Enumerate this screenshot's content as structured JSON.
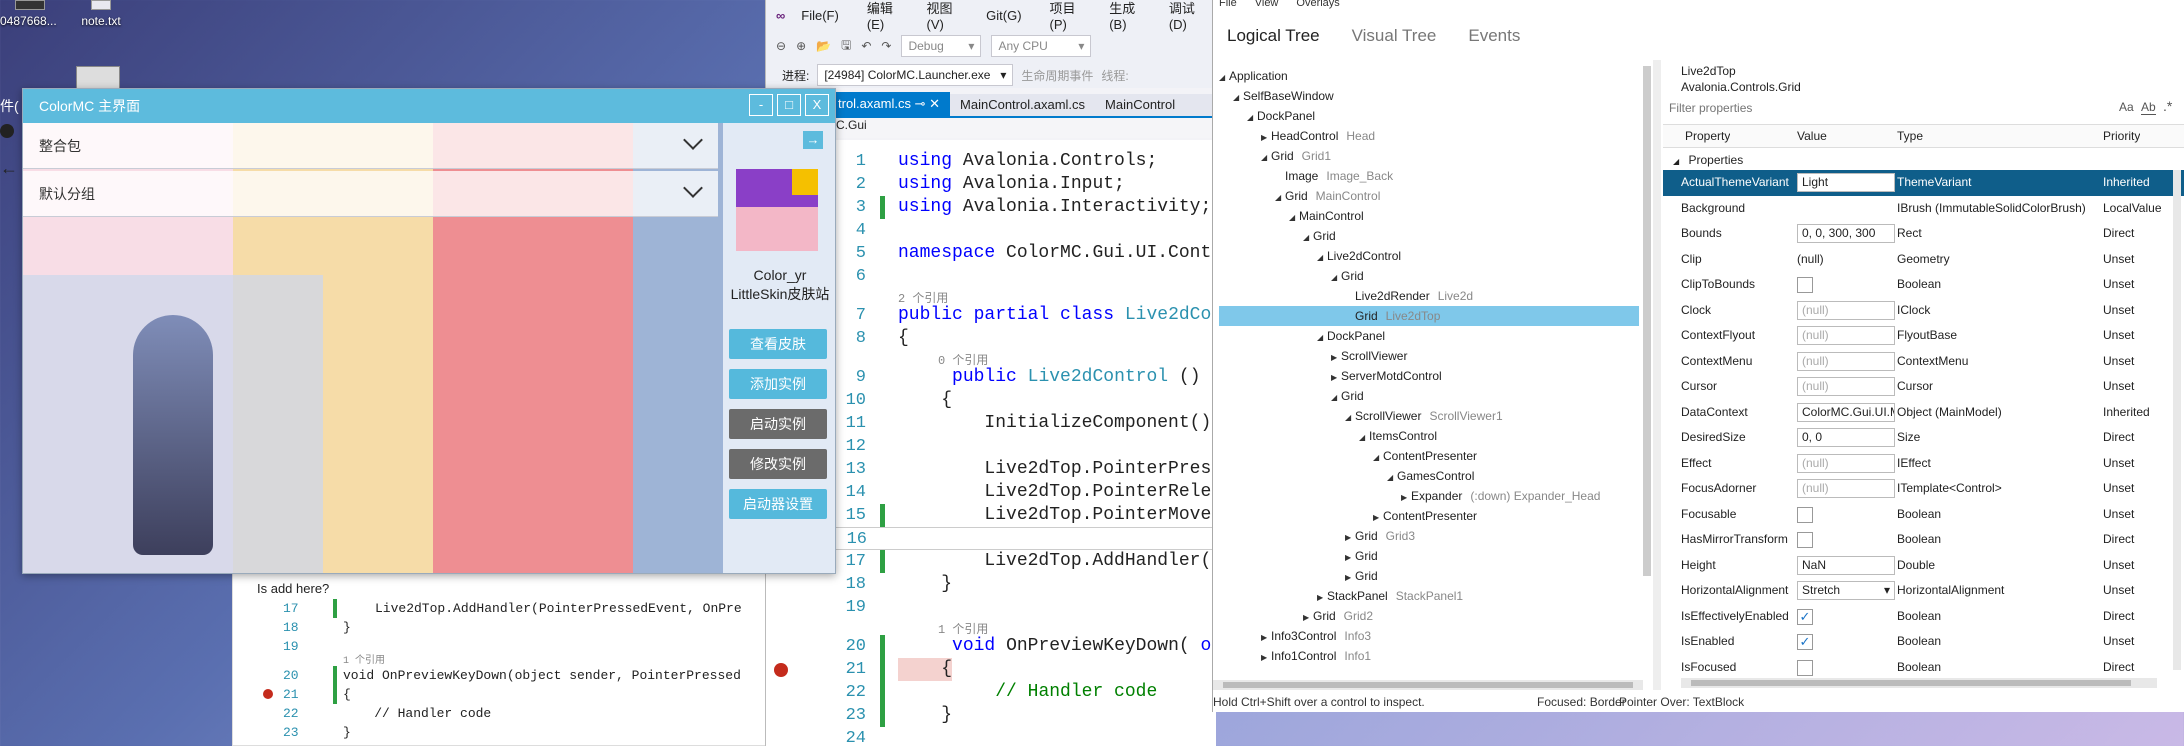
{
  "desktop": {
    "icons": [
      {
        "label": "0487668...",
        "icon": "image-file-icon"
      },
      {
        "label": "note.txt",
        "icon": "text-file-icon"
      }
    ],
    "left_fragment": "件(",
    "snippet_text": "Is add here?"
  },
  "vs": {
    "menu": [
      "File(F)",
      "编辑(E)",
      "视图(V)",
      "Git(G)",
      "项目(P)",
      "生成(B)",
      "调试(D)"
    ],
    "toolbar": {
      "config": "Debug",
      "platform": "Any CPU"
    },
    "process_label": "进程:",
    "process_value": "[24984] ColorMC.Launcher.exe",
    "lifecycle_label": "生命周期事件",
    "thread_label": "线程:",
    "tabs": [
      {
        "label": "trol.axaml.cs",
        "active": true
      },
      {
        "label": "MainControl.axaml.cs",
        "active": false
      },
      {
        "label": "MainControl",
        "active": false
      }
    ],
    "breadcrumb": "C.Gui",
    "code_lines": [
      {
        "n": "1",
        "tokens": [
          [
            "kw",
            "using"
          ],
          [
            "",
            "Avalonia.Controls;"
          ]
        ]
      },
      {
        "n": "2",
        "tokens": [
          [
            "kw",
            "using"
          ],
          [
            "",
            "Avalonia.Input;"
          ]
        ]
      },
      {
        "n": "3",
        "tokens": [
          [
            "kw",
            "using"
          ],
          [
            "",
            "Avalonia.Interactivity;"
          ]
        ]
      },
      {
        "n": "4",
        "tokens": []
      },
      {
        "n": "5",
        "tokens": [
          [
            "kw",
            "namespace"
          ],
          [
            "",
            "ColorMC.Gui.UI.Control"
          ]
        ]
      },
      {
        "n": "6",
        "tokens": []
      },
      {
        "n": "7",
        "tokens": [
          [
            "kw",
            "public partial class"
          ],
          [
            "ty",
            "Live2dCont"
          ]
        ]
      },
      {
        "n": "8",
        "tokens": [
          [
            "",
            "{"
          ]
        ]
      },
      {
        "n": "9",
        "tokens": [
          [
            "",
            "    "
          ],
          [
            "kw",
            "public"
          ],
          [
            "ty",
            "Live2dControl"
          ],
          [
            "",
            "()"
          ]
        ]
      },
      {
        "n": "10",
        "tokens": [
          [
            "",
            "    {"
          ]
        ]
      },
      {
        "n": "11",
        "tokens": [
          [
            "",
            "        InitializeComponent();"
          ]
        ]
      },
      {
        "n": "12",
        "tokens": []
      },
      {
        "n": "13",
        "tokens": [
          [
            "",
            "        Live2dTop.PointerPresse"
          ]
        ]
      },
      {
        "n": "14",
        "tokens": [
          [
            "",
            "        Live2dTop.PointerRelease"
          ]
        ]
      },
      {
        "n": "15",
        "tokens": [
          [
            "",
            "        Live2dTop.PointerMoved +"
          ]
        ]
      },
      {
        "n": "16",
        "tokens": []
      },
      {
        "n": "17",
        "tokens": [
          [
            "",
            "        Live2dTop.AddHandler(Poi"
          ]
        ]
      },
      {
        "n": "18",
        "tokens": [
          [
            "",
            "    }"
          ]
        ]
      },
      {
        "n": "19",
        "tokens": []
      },
      {
        "n": "20",
        "tokens": [
          [
            "",
            "    "
          ],
          [
            "kw",
            "void"
          ],
          [
            "",
            "OnPreviewKeyDown("
          ],
          [
            "kw",
            "object"
          ]
        ]
      },
      {
        "n": "21",
        "tokens": [
          [
            "",
            "    {"
          ]
        ]
      },
      {
        "n": "22",
        "tokens": [
          [
            "",
            "        "
          ],
          [
            "cm",
            "// Handler code"
          ]
        ]
      },
      {
        "n": "23",
        "tokens": [
          [
            "",
            "    }"
          ]
        ]
      },
      {
        "n": "24",
        "tokens": []
      }
    ],
    "refs": {
      "r2": "2 个引用",
      "r0": "0 个引用",
      "r1": "1 个引用"
    }
  },
  "bg_editor": {
    "lines": [
      {
        "n": "17",
        "text": "Live2dTop.AddHandler(PointerPressedEvent, OnPre"
      },
      {
        "n": "18",
        "text": "}"
      },
      {
        "n": "19",
        "text": ""
      },
      {
        "n": "20",
        "text": "void OnPreviewKeyDown(object sender, PointerPressed"
      },
      {
        "n": "21",
        "text": "{"
      },
      {
        "n": "22",
        "text": "    // Handler code"
      },
      {
        "n": "23",
        "text": "}"
      }
    ],
    "ref_label": "1 个引用"
  },
  "colormc": {
    "title": "ColorMC 主界面",
    "groups": [
      "整合包",
      "默认分组"
    ],
    "user_name": "Color_yr",
    "user_type": "LittleSkin皮肤站",
    "buttons": [
      {
        "label": "查看皮肤",
        "enabled": true
      },
      {
        "label": "添加实例",
        "enabled": true
      },
      {
        "label": "启动实例",
        "enabled": false
      },
      {
        "label": "修改实例",
        "enabled": false
      },
      {
        "label": "启动器设置",
        "enabled": true
      }
    ],
    "window_buttons": [
      "-",
      "□",
      "X"
    ]
  },
  "inspector": {
    "menu": [
      "File",
      "View",
      "Overlays"
    ],
    "tabs": [
      "Logical Tree",
      "Visual Tree",
      "Events"
    ],
    "tree": [
      {
        "indent": 0,
        "exp": "open",
        "name": "Application",
        "tname": ""
      },
      {
        "indent": 1,
        "exp": "open",
        "name": "SelfBaseWindow",
        "tname": ""
      },
      {
        "indent": 2,
        "exp": "open",
        "name": "DockPanel",
        "tname": ""
      },
      {
        "indent": 3,
        "exp": "closed",
        "name": "HeadControl",
        "tname": "Head"
      },
      {
        "indent": 3,
        "exp": "open",
        "name": "Grid",
        "tname": "Grid1"
      },
      {
        "indent": 4,
        "exp": "",
        "name": "Image",
        "tname": "Image_Back"
      },
      {
        "indent": 4,
        "exp": "open",
        "name": "Grid",
        "tname": "MainControl"
      },
      {
        "indent": 5,
        "exp": "open",
        "name": "MainControl",
        "tname": ""
      },
      {
        "indent": 6,
        "exp": "open",
        "name": "Grid",
        "tname": ""
      },
      {
        "indent": 7,
        "exp": "open",
        "name": "Live2dControl",
        "tname": ""
      },
      {
        "indent": 8,
        "exp": "open",
        "name": "Grid",
        "tname": ""
      },
      {
        "indent": 9,
        "exp": "",
        "name": "Live2dRender",
        "tname": "Live2d"
      },
      {
        "indent": 9,
        "exp": "",
        "name": "Grid",
        "tname": "Live2dTop",
        "selected": true
      },
      {
        "indent": 7,
        "exp": "open",
        "name": "DockPanel",
        "tname": ""
      },
      {
        "indent": 8,
        "exp": "closed",
        "name": "ScrollViewer",
        "tname": ""
      },
      {
        "indent": 8,
        "exp": "closed",
        "name": "ServerMotdControl",
        "tname": ""
      },
      {
        "indent": 8,
        "exp": "open",
        "name": "Grid",
        "tname": ""
      },
      {
        "indent": 9,
        "exp": "open",
        "name": "ScrollViewer",
        "tname": "ScrollViewer1"
      },
      {
        "indent": 10,
        "exp": "open",
        "name": "ItemsControl",
        "tname": ""
      },
      {
        "indent": 11,
        "exp": "open",
        "name": "ContentPresenter",
        "tname": ""
      },
      {
        "indent": 12,
        "exp": "open",
        "name": "GamesControl",
        "tname": ""
      },
      {
        "indent": 13,
        "exp": "closed",
        "name": "Expander",
        "tname": "(:down)  Expander_Head"
      },
      {
        "indent": 11,
        "exp": "closed",
        "name": "ContentPresenter",
        "tname": ""
      },
      {
        "indent": 9,
        "exp": "closed",
        "name": "Grid",
        "tname": "Grid3"
      },
      {
        "indent": 9,
        "exp": "closed",
        "name": "Grid",
        "tname": ""
      },
      {
        "indent": 9,
        "exp": "closed",
        "name": "Grid",
        "tname": ""
      },
      {
        "indent": 7,
        "exp": "closed",
        "name": "StackPanel",
        "tname": "StackPanel1"
      },
      {
        "indent": 6,
        "exp": "closed",
        "name": "Grid",
        "tname": "Grid2"
      },
      {
        "indent": 3,
        "exp": "closed",
        "name": "Info3Control",
        "tname": "Info3"
      },
      {
        "indent": 3,
        "exp": "closed",
        "name": "Info1Control",
        "tname": "Info1"
      }
    ],
    "selected_name": "Live2dTop",
    "selected_type": "Avalonia.Controls.Grid",
    "filter_placeholder": "Filter properties",
    "columns": [
      "Property",
      "Value",
      "Type",
      "Priority"
    ],
    "group_label": "Properties",
    "properties": [
      {
        "name": "ActualThemeVariant",
        "value": "Light",
        "kind": "box",
        "type": "ThemeVariant",
        "priority": "Inherited",
        "selected": true
      },
      {
        "name": "Background",
        "value": "",
        "kind": "none",
        "type": "IBrush (ImmutableSolidColorBrush)",
        "priority": "LocalValue"
      },
      {
        "name": "Bounds",
        "value": "0, 0, 300, 300",
        "kind": "box",
        "type": "Rect",
        "priority": "Direct"
      },
      {
        "name": "Clip",
        "value": "(null)",
        "kind": "text",
        "type": "Geometry",
        "priority": "Unset"
      },
      {
        "name": "ClipToBounds",
        "value": "",
        "kind": "check",
        "checked": false,
        "type": "Boolean",
        "priority": "Unset"
      },
      {
        "name": "Clock",
        "value": "(null)",
        "kind": "nullbox",
        "type": "IClock",
        "priority": "Unset"
      },
      {
        "name": "ContextFlyout",
        "value": "(null)",
        "kind": "nullbox",
        "type": "FlyoutBase",
        "priority": "Unset"
      },
      {
        "name": "ContextMenu",
        "value": "(null)",
        "kind": "nullbox",
        "type": "ContextMenu",
        "priority": "Unset"
      },
      {
        "name": "Cursor",
        "value": "(null)",
        "kind": "nullbox",
        "type": "Cursor",
        "priority": "Unset"
      },
      {
        "name": "DataContext",
        "value": "ColorMC.Gui.UI.M",
        "kind": "box",
        "type": "Object (MainModel)",
        "priority": "Inherited"
      },
      {
        "name": "DesiredSize",
        "value": "0, 0",
        "kind": "box",
        "type": "Size",
        "priority": "Direct"
      },
      {
        "name": "Effect",
        "value": "(null)",
        "kind": "nullbox",
        "type": "IEffect",
        "priority": "Unset"
      },
      {
        "name": "FocusAdorner",
        "value": "(null)",
        "kind": "nullbox",
        "type": "ITemplate<Control>",
        "priority": "Unset"
      },
      {
        "name": "Focusable",
        "value": "",
        "kind": "check",
        "checked": false,
        "type": "Boolean",
        "priority": "Unset"
      },
      {
        "name": "HasMirrorTransform",
        "value": "",
        "kind": "check",
        "checked": false,
        "type": "Boolean",
        "priority": "Direct"
      },
      {
        "name": "Height",
        "value": "NaN",
        "kind": "box",
        "type": "Double",
        "priority": "Unset"
      },
      {
        "name": "HorizontalAlignment",
        "value": "Stretch",
        "kind": "select",
        "type": "HorizontalAlignment",
        "priority": "Unset"
      },
      {
        "name": "IsEffectivelyEnabled",
        "value": "",
        "kind": "check",
        "checked": true,
        "type": "Boolean",
        "priority": "Direct"
      },
      {
        "name": "IsEnabled",
        "value": "",
        "kind": "check",
        "checked": true,
        "type": "Boolean",
        "priority": "Unset"
      },
      {
        "name": "IsFocused",
        "value": "",
        "kind": "check",
        "checked": false,
        "type": "Boolean",
        "priority": "Direct"
      }
    ],
    "status": {
      "hint": "Hold Ctrl+Shift over a control to inspect.",
      "focused": "Focused: Border",
      "pointer": "Pointer Over: TextBlock"
    }
  }
}
